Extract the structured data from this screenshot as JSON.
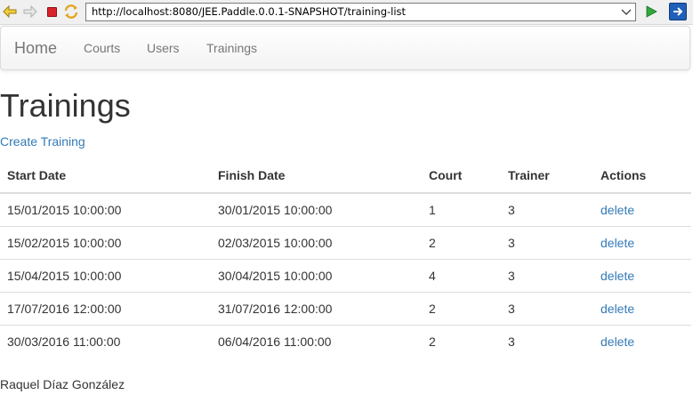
{
  "browser": {
    "url": "http://localhost:8080/JEE.Paddle.0.0.1-SNAPSHOT/training-list"
  },
  "navbar": {
    "brand": "Home",
    "links": [
      "Courts",
      "Users",
      "Trainings"
    ]
  },
  "main": {
    "title": "Trainings",
    "create_link": "Create Training",
    "table": {
      "headers": [
        "Start Date",
        "Finish Date",
        "Court",
        "Trainer",
        "Actions"
      ],
      "rows": [
        {
          "start": "15/01/2015 10:00:00",
          "finish": "30/01/2015 10:00:00",
          "court": "1",
          "trainer": "3",
          "action": "delete"
        },
        {
          "start": "15/02/2015 10:00:00",
          "finish": "02/03/2015 10:00:00",
          "court": "2",
          "trainer": "3",
          "action": "delete"
        },
        {
          "start": "15/04/2015 10:00:00",
          "finish": "30/04/2015 10:00:00",
          "court": "4",
          "trainer": "3",
          "action": "delete"
        },
        {
          "start": "17/07/2016 12:00:00",
          "finish": "31/07/2016 12:00:00",
          "court": "2",
          "trainer": "3",
          "action": "delete"
        },
        {
          "start": "30/03/2016 11:00:00",
          "finish": "06/04/2016 11:00:00",
          "court": "2",
          "trainer": "3",
          "action": "delete"
        }
      ]
    }
  },
  "footer": {
    "author": "Raquel Díaz González"
  },
  "icons": {
    "back": "back-arrow-icon",
    "forward": "forward-arrow-icon",
    "stop": "stop-icon",
    "refresh": "refresh-icon",
    "go": "go-icon",
    "extension": "extension-icon"
  },
  "colors": {
    "link": "#337ab7",
    "text": "#333333",
    "nav_text": "#777777",
    "stop_red": "#d9232b"
  }
}
